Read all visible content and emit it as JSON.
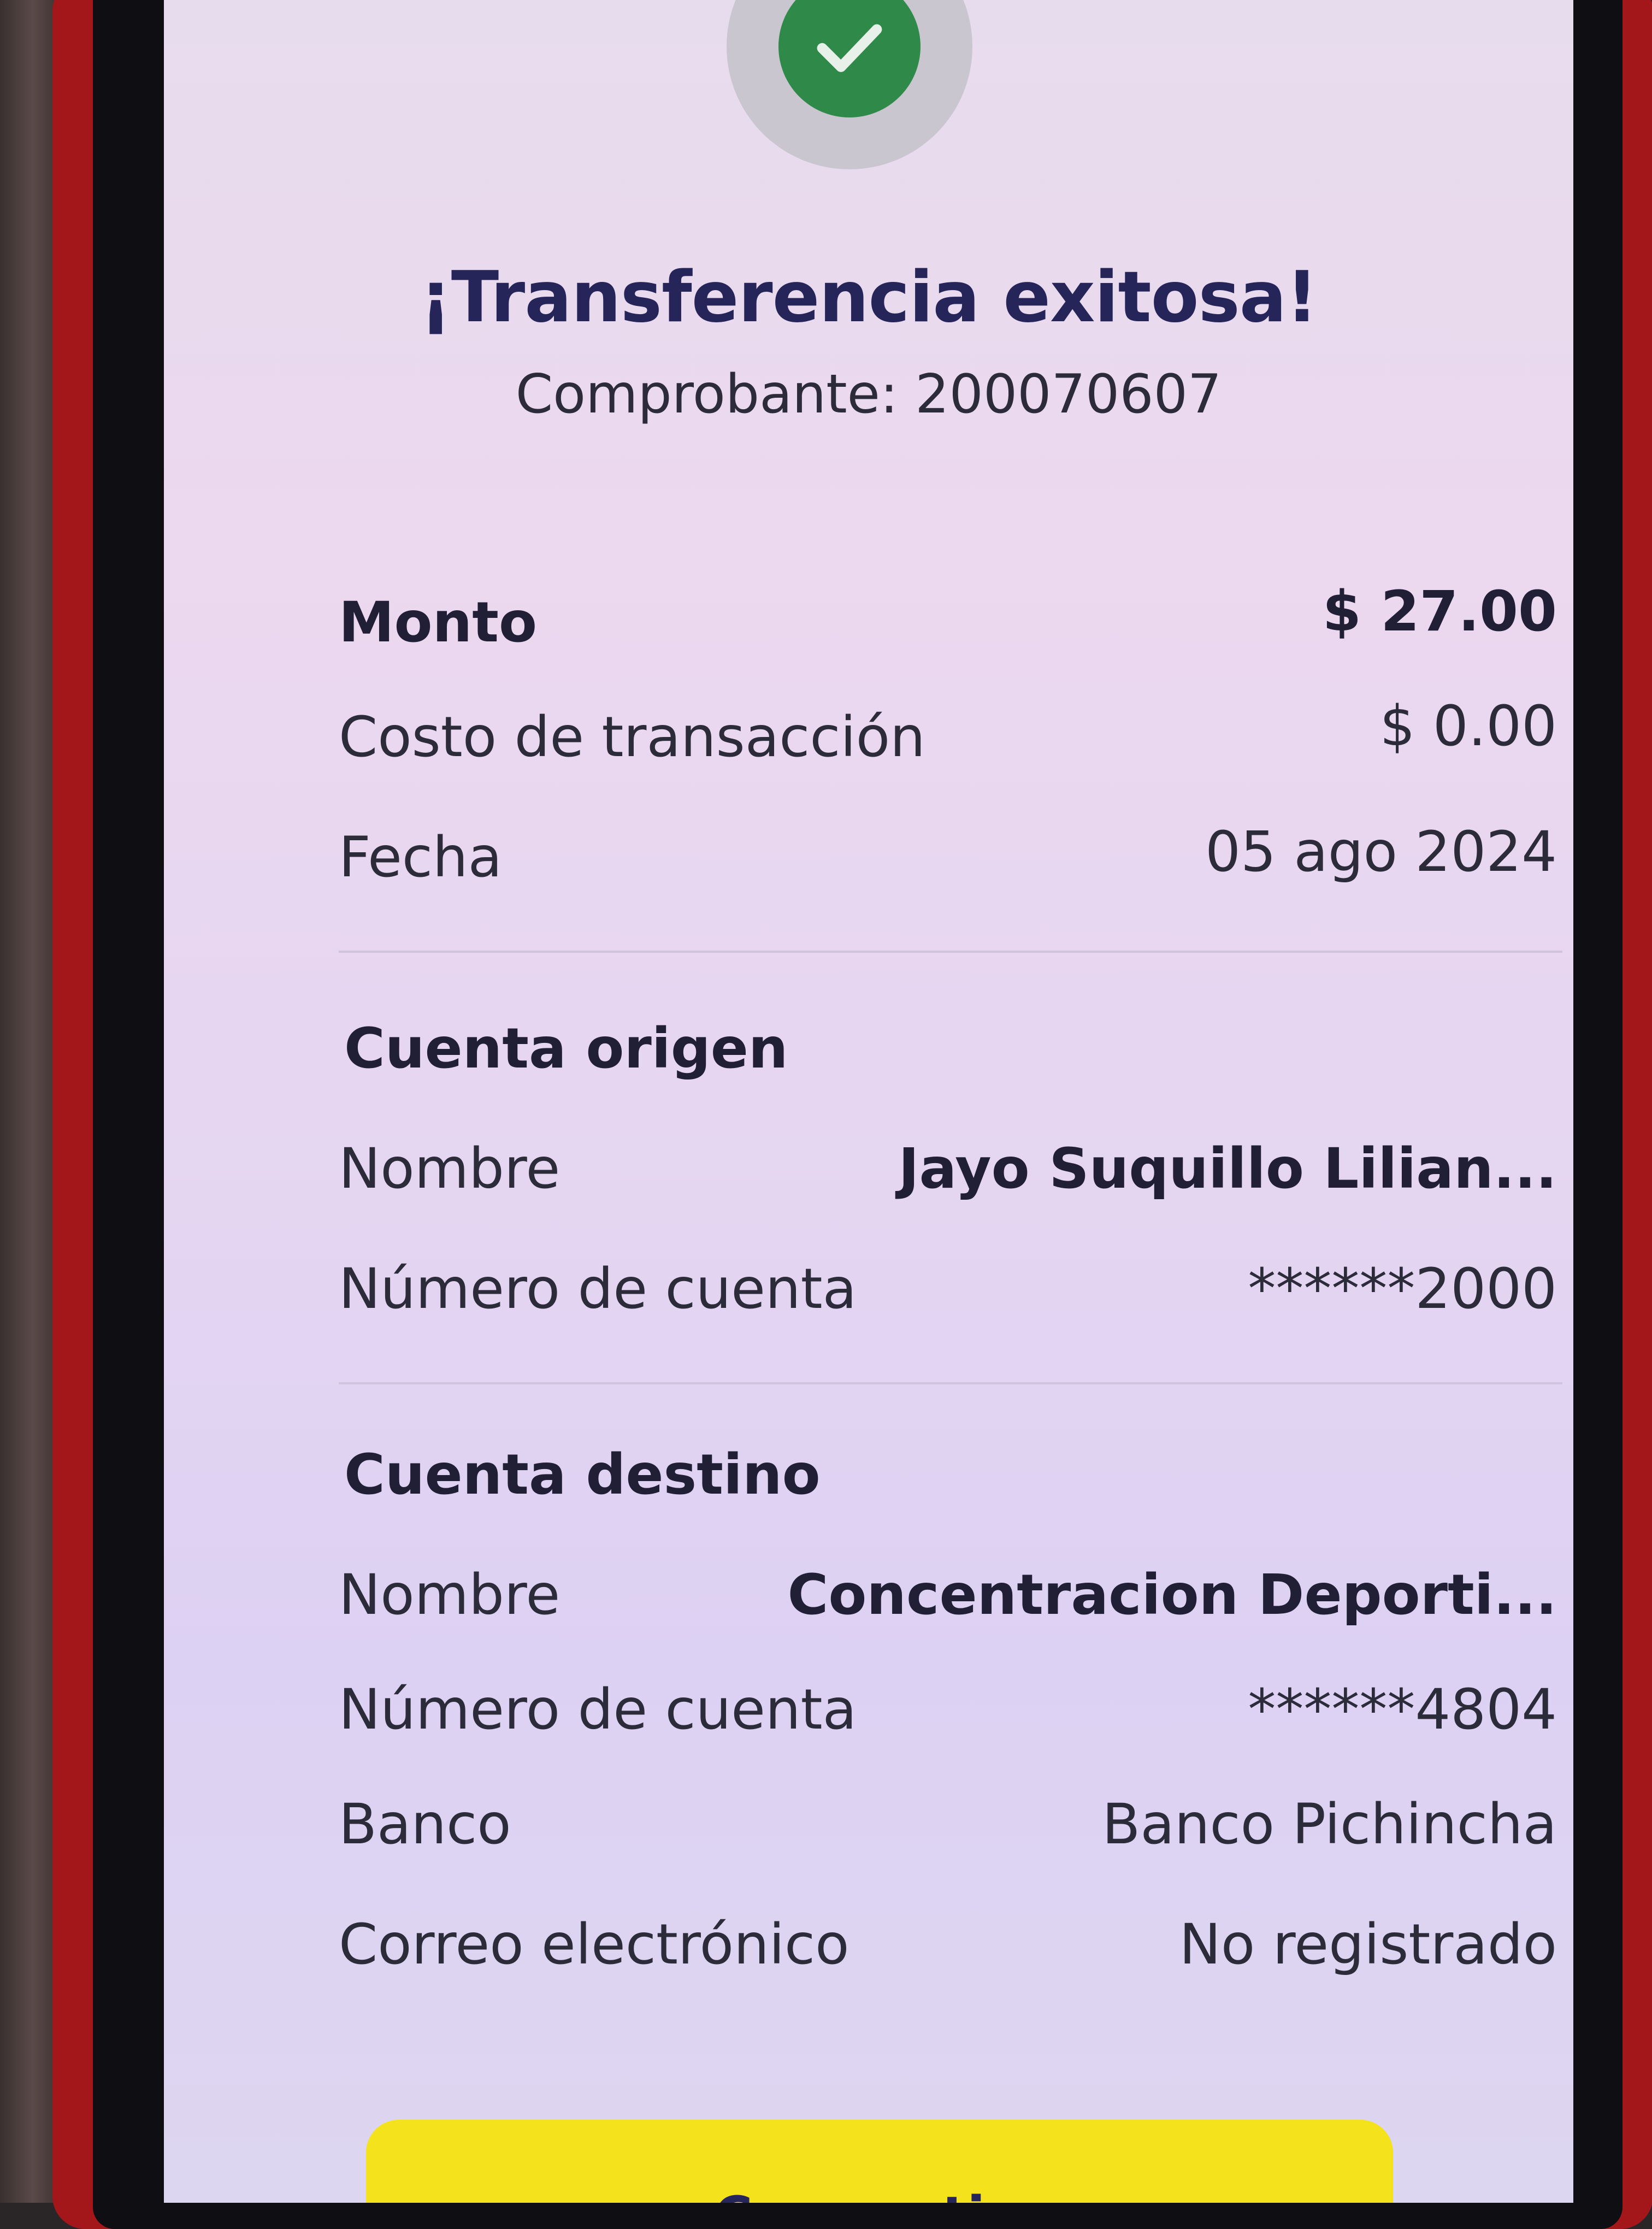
{
  "header": {
    "title": "¡Transferencia exitosa!",
    "receipt": "Comprobante: 200070607"
  },
  "summary": {
    "amount_label": "Monto",
    "amount_value": "$ 27.00",
    "fee_label": "Costo de transacción",
    "fee_value": "$ 0.00",
    "date_label": "Fecha",
    "date_value": "05 ago 2024"
  },
  "origin": {
    "section_title": "Cuenta origen",
    "name_label": "Nombre",
    "name_value": "Jayo  Suquillo Lilian...",
    "account_label": "Número de cuenta",
    "account_value": "******2000"
  },
  "destination": {
    "section_title": "Cuenta destino",
    "name_label": "Nombre",
    "name_value": "Concentracion Deporti...",
    "account_label": "Número de cuenta",
    "account_value": "******4804",
    "bank_label": "Banco",
    "bank_value": "Banco Pichincha",
    "email_label": "Correo electrónico",
    "email_value": "No registrado"
  },
  "actions": {
    "share_label": "Comparti..."
  },
  "icons": {
    "success": "check-icon"
  },
  "colors": {
    "success_green": "#2f8a4a",
    "primary_text": "#26255a",
    "button_yellow": "#f3e21c"
  }
}
